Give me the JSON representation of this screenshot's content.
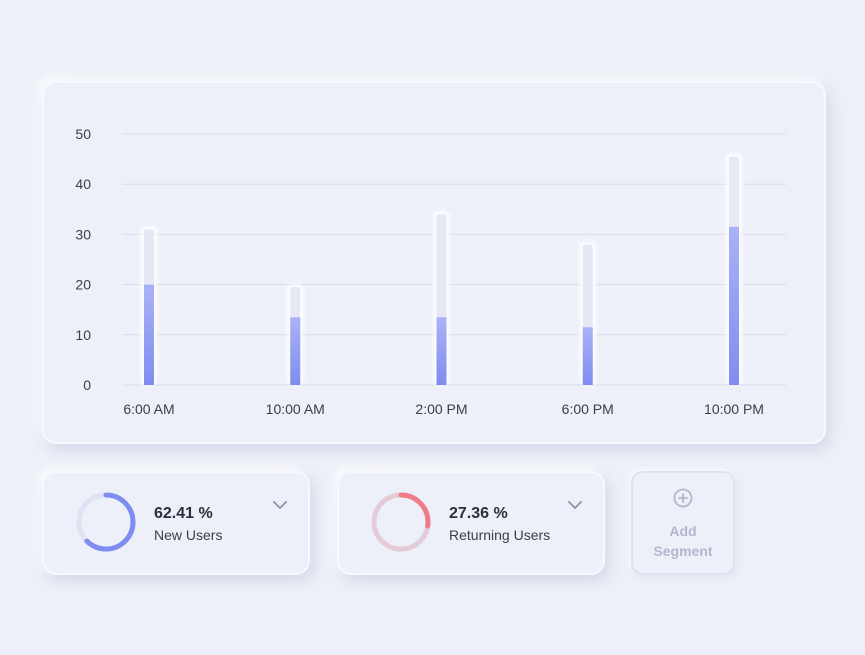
{
  "chart_data": {
    "type": "bar",
    "categories": [
      "6:00 AM",
      "10:00 AM",
      "2:00 PM",
      "6:00 PM",
      "10:00 PM"
    ],
    "series": [
      {
        "values": [
          31,
          19.5,
          34,
          28,
          45.5
        ]
      },
      {
        "values": [
          20,
          13.5,
          13.5,
          11.5,
          31.5
        ]
      }
    ],
    "y_ticks": [
      "0",
      "10",
      "20",
      "30",
      "40",
      "50"
    ],
    "ylim": [
      0,
      50
    ],
    "grid": true,
    "colors": {
      "track": "#e6e9f4",
      "fill": "#7f8df0",
      "fill_top": "#aab2f6",
      "grid": "#d8dbea"
    }
  },
  "stats": [
    {
      "value": "62.41 %",
      "label": "New Users",
      "percent": 62.41,
      "color": "#7f8df0",
      "track_color": "#dfe2f2"
    },
    {
      "value": "27.36 %",
      "label": "Returning Users",
      "percent": 27.36,
      "color": "#f07c8a",
      "track_color": "#e4ccd6"
    }
  ],
  "add_segment": {
    "line1": "Add",
    "line2": "Segment",
    "icon": "plus-circle-icon",
    "color": "#b2b7cd"
  }
}
